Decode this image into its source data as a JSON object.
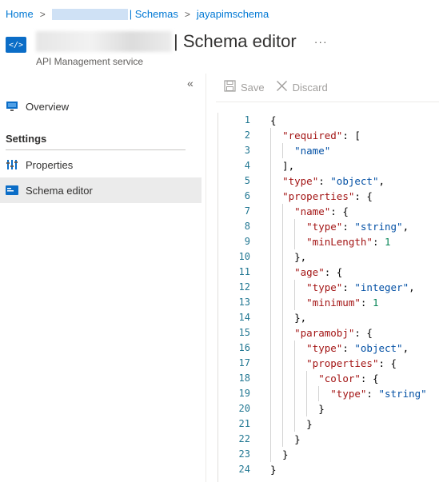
{
  "breadcrumb": {
    "home": "Home",
    "schemas": "| Schemas",
    "current": "jayapimschema",
    "sep": ">"
  },
  "header": {
    "title": "| Schema editor",
    "more": "···",
    "subtitle": "API Management service",
    "service_icon": "</>"
  },
  "sidebar": {
    "collapse": "«",
    "overview": "Overview",
    "section_settings": "Settings",
    "items": [
      {
        "label": "Properties",
        "icon": "properties-icon"
      },
      {
        "label": "Schema editor",
        "icon": "schema-editor-icon",
        "selected": true
      }
    ]
  },
  "toolbar": {
    "save": "Save",
    "discard": "Discard"
  },
  "editor": {
    "lines": [
      "{",
      "  \"required\": [",
      "    \"name\"",
      "  ],",
      "  \"type\": \"object\",",
      "  \"properties\": {",
      "    \"name\": {",
      "      \"type\": \"string\",",
      "      \"minLength\": 1",
      "    },",
      "    \"age\": {",
      "      \"type\": \"integer\",",
      "      \"minimum\": 1",
      "    },",
      "    \"paramobj\": {",
      "      \"type\": \"object\",",
      "      \"properties\": {",
      "        \"color\": {",
      "          \"type\": \"string\"",
      "        }",
      "      }",
      "    }",
      "  }",
      "}"
    ]
  },
  "colors": {
    "accent": "#0078d4",
    "line_number": "#237893",
    "json_key": "#a31515",
    "json_string": "#0451a5",
    "json_number": "#098658"
  }
}
